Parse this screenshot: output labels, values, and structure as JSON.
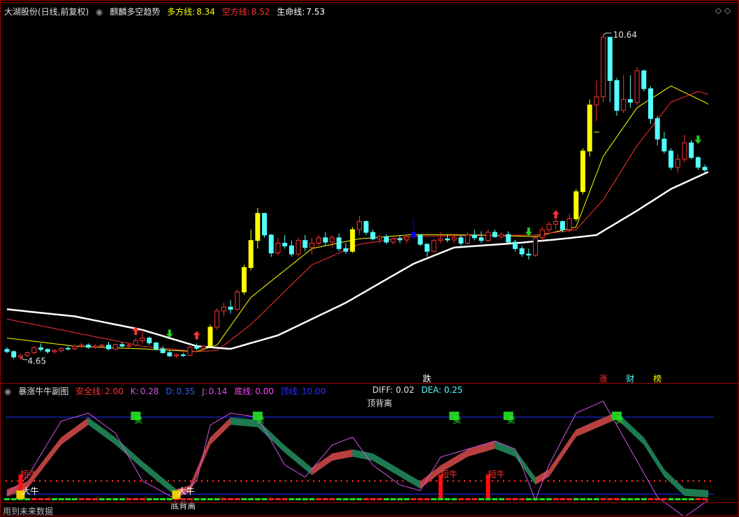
{
  "header": {
    "stock": "大湖股份(日线,前复权)",
    "indicator": "麒麟多空趋势",
    "dfx_label": "多方线:",
    "dfx_value": "8.34",
    "kfx_label": "空方线:",
    "kfx_value": "8.52",
    "smx_label": "生命线:",
    "smx_value": "7.53"
  },
  "sub_header": {
    "name": "暴涨牛牛副图",
    "safe_label": "安全线:",
    "safe_value": "2.00",
    "k_label": "K:",
    "k_value": "0.28",
    "d_label": "D:",
    "d_value": "0.35",
    "j_label": "J:",
    "j_value": "0.14",
    "bottom_label": "底线:",
    "bottom_value": "0.00",
    "top_label": "顶线:",
    "top_value": "10.00",
    "diff_label": "DIFF:",
    "diff_value": "0.02",
    "dea_label": "DEA:",
    "dea_value": "0.25"
  },
  "footer": "用到未来数据",
  "colors": {
    "bg": "#000000",
    "up": "#ff3232",
    "down": "#54ffff",
    "yellow": "#ffff00",
    "blue": "#0000ff",
    "white": "#ffffff",
    "magenta": "#d155e8",
    "bear": "#1e7a50",
    "bull": "#b84040",
    "grid": "#a00000"
  },
  "chart_data": [
    {
      "type": "candlestick",
      "title": "大湖股份(日线,前复权)",
      "price_range": [
        4.4,
        10.9
      ],
      "labels": {
        "high": "10.64",
        "low": "4.65"
      },
      "ohlc": [
        [
          4.84,
          4.88,
          4.77,
          4.8
        ],
        [
          4.8,
          4.82,
          4.66,
          4.7
        ],
        [
          4.7,
          4.76,
          4.65,
          4.73
        ],
        [
          4.73,
          4.8,
          4.7,
          4.78
        ],
        [
          4.78,
          4.9,
          4.75,
          4.87
        ],
        [
          4.87,
          4.95,
          4.8,
          4.84
        ],
        [
          4.84,
          4.86,
          4.76,
          4.8
        ],
        [
          4.8,
          4.85,
          4.76,
          4.82
        ],
        [
          4.82,
          4.88,
          4.78,
          4.86
        ],
        [
          4.86,
          4.9,
          4.82,
          4.85
        ],
        [
          4.85,
          4.93,
          4.82,
          4.9
        ],
        [
          4.9,
          4.96,
          4.86,
          4.92
        ],
        [
          4.92,
          4.95,
          4.85,
          4.88
        ],
        [
          4.88,
          4.94,
          4.85,
          4.9
        ],
        [
          4.9,
          4.95,
          4.87,
          4.92
        ],
        [
          4.92,
          4.98,
          4.83,
          4.85
        ],
        [
          4.85,
          4.95,
          4.82,
          4.93
        ],
        [
          4.93,
          4.97,
          4.88,
          4.9
        ],
        [
          4.9,
          4.95,
          4.87,
          4.92
        ],
        [
          4.92,
          5.05,
          4.9,
          5.0
        ],
        [
          5.0,
          5.2,
          4.95,
          5.05
        ],
        [
          5.05,
          5.08,
          4.92,
          4.96
        ],
        [
          4.96,
          4.98,
          4.82,
          4.85
        ],
        [
          4.85,
          4.9,
          4.76,
          4.78
        ],
        [
          4.78,
          4.82,
          4.7,
          4.72
        ],
        [
          4.72,
          4.76,
          4.68,
          4.74
        ],
        [
          4.74,
          4.78,
          4.7,
          4.73
        ],
        [
          4.73,
          4.9,
          4.72,
          4.88
        ],
        [
          4.88,
          4.95,
          4.82,
          4.86
        ],
        [
          4.86,
          4.92,
          4.84,
          4.9
        ],
        [
          4.9,
          5.3,
          4.88,
          5.25
        ],
        [
          5.25,
          5.6,
          5.2,
          5.55
        ],
        [
          5.55,
          5.7,
          5.45,
          5.62
        ],
        [
          5.62,
          5.75,
          5.5,
          5.58
        ],
        [
          5.58,
          5.95,
          5.55,
          5.9
        ],
        [
          5.9,
          6.4,
          5.85,
          6.35
        ],
        [
          6.35,
          7.05,
          6.3,
          6.85
        ],
        [
          6.85,
          7.45,
          6.7,
          7.35
        ],
        [
          7.35,
          7.25,
          6.9,
          6.95
        ],
        [
          6.95,
          6.97,
          6.55,
          6.62
        ],
        [
          6.62,
          6.9,
          6.58,
          6.8
        ],
        [
          6.8,
          6.95,
          6.7,
          6.75
        ],
        [
          6.75,
          6.85,
          6.55,
          6.6
        ],
        [
          6.6,
          6.9,
          6.55,
          6.85
        ],
        [
          6.85,
          6.95,
          6.65,
          6.72
        ],
        [
          6.72,
          6.9,
          6.6,
          6.8
        ],
        [
          6.8,
          6.95,
          6.75,
          6.9
        ],
        [
          6.9,
          7.0,
          6.75,
          6.82
        ],
        [
          6.82,
          6.95,
          6.72,
          6.9
        ],
        [
          6.9,
          6.98,
          6.65,
          6.7
        ],
        [
          6.7,
          6.8,
          6.6,
          6.65
        ],
        [
          6.65,
          7.1,
          6.62,
          7.05
        ],
        [
          7.05,
          7.3,
          6.95,
          7.2
        ],
        [
          7.2,
          7.22,
          6.95,
          7.0
        ],
        [
          7.0,
          7.05,
          6.85,
          6.88
        ],
        [
          6.88,
          6.95,
          6.8,
          6.92
        ],
        [
          6.92,
          6.96,
          6.78,
          6.82
        ],
        [
          6.82,
          6.9,
          6.78,
          6.88
        ],
        [
          6.88,
          6.95,
          6.8,
          6.86
        ],
        [
          6.86,
          6.96,
          6.8,
          6.92
        ],
        [
          6.92,
          7.25,
          6.88,
          7.0
        ],
        [
          6.95,
          6.96,
          6.75,
          6.78
        ],
        [
          6.78,
          6.8,
          6.55,
          6.65
        ],
        [
          6.65,
          6.88,
          6.62,
          6.85
        ],
        [
          6.85,
          7.0,
          6.8,
          6.88
        ],
        [
          6.88,
          6.95,
          6.82,
          6.86
        ],
        [
          6.86,
          6.98,
          6.8,
          6.9
        ],
        [
          6.9,
          6.95,
          6.75,
          6.8
        ],
        [
          6.8,
          7.0,
          6.78,
          6.95
        ],
        [
          6.95,
          7.05,
          6.85,
          6.9
        ],
        [
          6.9,
          7.02,
          6.8,
          6.85
        ],
        [
          6.85,
          7.05,
          6.82,
          7.0
        ],
        [
          7.0,
          7.05,
          6.9,
          6.92
        ],
        [
          6.92,
          7.0,
          6.88,
          6.96
        ],
        [
          6.96,
          7.02,
          6.8,
          6.82
        ],
        [
          6.82,
          6.86,
          6.65,
          6.7
        ],
        [
          6.7,
          6.75,
          6.55,
          6.6
        ],
        [
          6.6,
          6.7,
          6.5,
          6.58
        ],
        [
          6.58,
          6.95,
          6.55,
          6.9
        ],
        [
          6.9,
          7.1,
          6.85,
          7.05
        ],
        [
          7.05,
          7.2,
          7.0,
          7.15
        ],
        [
          7.15,
          7.25,
          7.05,
          7.2
        ],
        [
          7.2,
          7.22,
          7.0,
          7.05
        ],
        [
          7.05,
          7.35,
          7.0,
          7.25
        ],
        [
          7.25,
          7.8,
          7.2,
          7.75
        ],
        [
          7.75,
          8.55,
          7.7,
          8.5
        ],
        [
          8.5,
          9.45,
          8.4,
          9.35
        ],
        [
          9.35,
          9.8,
          9.05,
          9.5
        ],
        [
          9.5,
          10.64,
          9.4,
          10.6
        ],
        [
          10.6,
          10.4,
          9.4,
          9.8
        ],
        [
          9.8,
          9.85,
          9.15,
          9.25
        ],
        [
          9.25,
          9.9,
          9.2,
          9.45
        ],
        [
          9.45,
          9.9,
          9.3,
          9.4
        ],
        [
          9.4,
          10.05,
          9.35,
          9.98
        ],
        [
          9.98,
          10.0,
          9.6,
          9.65
        ],
        [
          9.65,
          9.7,
          9.0,
          9.1
        ],
        [
          9.1,
          9.15,
          8.6,
          8.72
        ],
        [
          8.72,
          8.85,
          8.45,
          8.5
        ],
        [
          8.5,
          8.55,
          8.15,
          8.2
        ],
        [
          8.2,
          8.45,
          8.1,
          8.35
        ],
        [
          8.35,
          8.8,
          8.3,
          8.65
        ],
        [
          8.65,
          8.7,
          8.35,
          8.38
        ],
        [
          8.38,
          8.4,
          8.15,
          8.2
        ],
        [
          8.2,
          8.25,
          8.1,
          8.15
        ]
      ],
      "special_bars": {
        "yellow": [
          30,
          35,
          36,
          37,
          51,
          84,
          85,
          86
        ],
        "blue": [
          60
        ]
      },
      "arrows_up": [
        19,
        28,
        81
      ],
      "arrows_down": [
        24,
        77,
        102
      ],
      "series": [
        {
          "name": "多方线",
          "color": "#ffff00",
          "anchors": [
            [
              0,
              5.05
            ],
            [
              10,
              4.9
            ],
            [
              20,
              4.85
            ],
            [
              28,
              4.8
            ],
            [
              31,
              4.92
            ],
            [
              36,
              5.8
            ],
            [
              45,
              6.7
            ],
            [
              52,
              6.88
            ],
            [
              60,
              6.96
            ],
            [
              70,
              6.95
            ],
            [
              78,
              6.92
            ],
            [
              84,
              7.1
            ],
            [
              88,
              8.4
            ],
            [
              93,
              9.3
            ],
            [
              98,
              9.7
            ],
            [
              103,
              9.4
            ],
            [
              105,
              9.25
            ]
          ]
        },
        {
          "name": "空方线",
          "color": "#ff3232",
          "anchors": [
            [
              0,
              5.4
            ],
            [
              10,
              5.15
            ],
            [
              20,
              4.9
            ],
            [
              28,
              4.8
            ],
            [
              31,
              4.82
            ],
            [
              36,
              5.3
            ],
            [
              45,
              6.4
            ],
            [
              52,
              6.78
            ],
            [
              60,
              6.93
            ],
            [
              70,
              6.94
            ],
            [
              78,
              6.95
            ],
            [
              84,
              7.05
            ],
            [
              88,
              7.6
            ],
            [
              93,
              8.6
            ],
            [
              98,
              9.4
            ],
            [
              102,
              9.6
            ],
            [
              105,
              9.5
            ]
          ]
        },
        {
          "name": "生命线",
          "color": "#ffffff",
          "anchors": [
            [
              0,
              5.58
            ],
            [
              10,
              5.45
            ],
            [
              20,
              5.2
            ],
            [
              28,
              4.9
            ],
            [
              33,
              4.85
            ],
            [
              40,
              5.1
            ],
            [
              50,
              5.7
            ],
            [
              60,
              6.42
            ],
            [
              66,
              6.72
            ],
            [
              75,
              6.8
            ],
            [
              82,
              6.88
            ],
            [
              87,
              6.95
            ],
            [
              93,
              7.4
            ],
            [
              98,
              7.8
            ],
            [
              105,
              8.2
            ]
          ]
        }
      ],
      "markers": [
        {
          "index": 62,
          "text": "跌",
          "color": "#ffffff"
        },
        {
          "index": 88,
          "text": "涨",
          "color": "#ff3232"
        },
        {
          "index": 92,
          "text": "财",
          "color": "#54ffff"
        },
        {
          "index": 96,
          "text": "榜",
          "color": "#ffff00"
        }
      ]
    },
    {
      "type": "indicator",
      "title": "暴涨牛牛副图",
      "y_range": [
        -0.5,
        12
      ],
      "top_line": 10.0,
      "bottom_line": 0.0,
      "safe_line": 2.0,
      "annotations": [
        {
          "text": "顶背离",
          "index": 55,
          "position": "top"
        },
        {
          "text": "底背离",
          "index": 26,
          "position": "bottom"
        }
      ],
      "sell_signals": [
        19,
        37,
        66,
        74,
        90
      ],
      "sell_label": "卖",
      "buy_label": "大牛",
      "buy_signals": [
        2,
        25
      ],
      "bull_label": "短牛",
      "bull_signals": [
        2,
        64,
        71
      ],
      "k_anchors": [
        [
          0,
          0.5
        ],
        [
          3,
          1.5
        ],
        [
          8,
          7
        ],
        [
          12,
          9.5
        ],
        [
          16,
          7
        ],
        [
          20,
          4
        ],
        [
          25,
          0.5
        ],
        [
          27,
          1.0
        ],
        [
          30,
          7
        ],
        [
          33,
          9.5
        ],
        [
          37,
          9.2
        ],
        [
          41,
          6
        ],
        [
          45,
          3.2
        ],
        [
          48,
          5
        ],
        [
          51,
          5.5
        ],
        [
          54,
          5
        ],
        [
          58,
          3
        ],
        [
          61,
          1.5
        ],
        [
          64,
          3.5
        ],
        [
          68,
          5.5
        ],
        [
          72,
          6.5
        ],
        [
          75,
          5.5
        ],
        [
          78,
          2
        ],
        [
          80,
          3
        ],
        [
          84,
          8
        ],
        [
          90,
          10.2
        ],
        [
          94,
          7
        ],
        [
          97,
          3
        ],
        [
          100,
          0.6
        ],
        [
          105,
          0.3
        ]
      ],
      "j_anchors": [
        [
          0,
          0.3
        ],
        [
          3,
          2.5
        ],
        [
          8,
          9.5
        ],
        [
          12,
          10.5
        ],
        [
          16,
          8
        ],
        [
          20,
          2
        ],
        [
          25,
          -0.3
        ],
        [
          28,
          2
        ],
        [
          30,
          9
        ],
        [
          33,
          10.5
        ],
        [
          37,
          10
        ],
        [
          41,
          4
        ],
        [
          44,
          2.5
        ],
        [
          48,
          6.5
        ],
        [
          51,
          7.5
        ],
        [
          54,
          4
        ],
        [
          58,
          1.5
        ],
        [
          61,
          0.8
        ],
        [
          64,
          5
        ],
        [
          68,
          6
        ],
        [
          72,
          7
        ],
        [
          75,
          6
        ],
        [
          78,
          -0.4
        ],
        [
          80,
          4
        ],
        [
          84,
          10.5
        ],
        [
          88,
          12
        ],
        [
          92,
          6
        ],
        [
          96,
          0
        ],
        [
          100,
          -2.5
        ],
        [
          105,
          0.5
        ]
      ]
    }
  ]
}
